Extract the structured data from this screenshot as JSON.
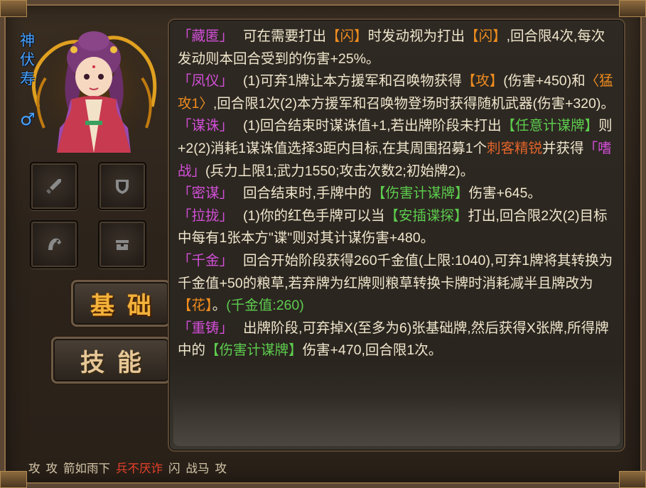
{
  "hero": {
    "name": "神伏寿",
    "gender_symbol": "♂"
  },
  "equipment_slots": [
    {
      "icon": "sword-icon"
    },
    {
      "icon": "shield-icon"
    },
    {
      "icon": "horse-icon"
    },
    {
      "icon": "treasure-icon"
    }
  ],
  "tabs": {
    "basic": "基础",
    "skill": "技能"
  },
  "skills": [
    {
      "name": "「藏匿」",
      "segments": [
        {
          "t": "可在需要打出"
        },
        {
          "t": "【闪】",
          "c": "orange"
        },
        {
          "t": "时发动视为打出"
        },
        {
          "t": "【闪】",
          "c": "orange"
        },
        {
          "t": ",回合限4次,每次发动则本回合受到的伤害+25%。"
        }
      ]
    },
    {
      "name": "「凤仪」",
      "segments": [
        {
          "t": "(1)可弃1牌让本方援军和召唤物获得"
        },
        {
          "t": "【攻】",
          "c": "orange"
        },
        {
          "t": "(伤害+450)和"
        },
        {
          "t": "〈猛攻1〉",
          "c": "orange"
        },
        {
          "t": ",回合限1次(2)本方援军和召唤物登场时获得随机武器(伤害+320)。"
        }
      ]
    },
    {
      "name": "「谋诛」",
      "segments": [
        {
          "t": "(1)回合结束时谋诛值+1,若出牌阶段未打出"
        },
        {
          "t": "【任意计谋牌】",
          "c": "green"
        },
        {
          "t": "则+2(2)消耗1谋诛值选择3距内目标,在其周围招募1个"
        },
        {
          "t": "刺客精锐",
          "c": "red"
        },
        {
          "t": "并获得"
        },
        {
          "t": "「嗜战」",
          "c": "purple"
        },
        {
          "t": "(兵力上限1;武力1550;攻击次数2;初始牌2)。"
        }
      ]
    },
    {
      "name": "「密谋」",
      "segments": [
        {
          "t": "回合结束时,手牌中的"
        },
        {
          "t": "【伤害计谋牌】",
          "c": "green"
        },
        {
          "t": "伤害+645。"
        }
      ]
    },
    {
      "name": "「拉拢」",
      "segments": [
        {
          "t": "(1)你的红色手牌可以当"
        },
        {
          "t": "【安插谍探】",
          "c": "green"
        },
        {
          "t": "打出,回合限2次(2)目标中每有1张本方\"谍\"则对其计谋伤害+480。"
        }
      ]
    },
    {
      "name": "「千金」",
      "segments": [
        {
          "t": "回合开始阶段获得260千金值(上限:1040),可弃1牌将其转换为千金值+50的粮草,若弃牌为红牌则粮草转换卡牌时消耗减半且牌改为"
        },
        {
          "t": "【花】",
          "c": "orange"
        },
        {
          "t": "。"
        },
        {
          "t": "(千金值:260)",
          "c": "green"
        }
      ]
    },
    {
      "name": "「重铸」",
      "segments": [
        {
          "t": "出牌阶段,可弃掉X(至多为6)张基础牌,然后获得X张牌,所得牌中的"
        },
        {
          "t": "【伤害计谋牌】",
          "c": "green"
        },
        {
          "t": "伤害+470,回合限1次。"
        }
      ]
    }
  ],
  "cards": [
    {
      "label": "攻"
    },
    {
      "label": "攻"
    },
    {
      "label": "箭如雨下"
    },
    {
      "label": "兵不厌诈",
      "red": true
    },
    {
      "label": "闪"
    },
    {
      "label": "战马"
    },
    {
      "label": "攻"
    }
  ]
}
